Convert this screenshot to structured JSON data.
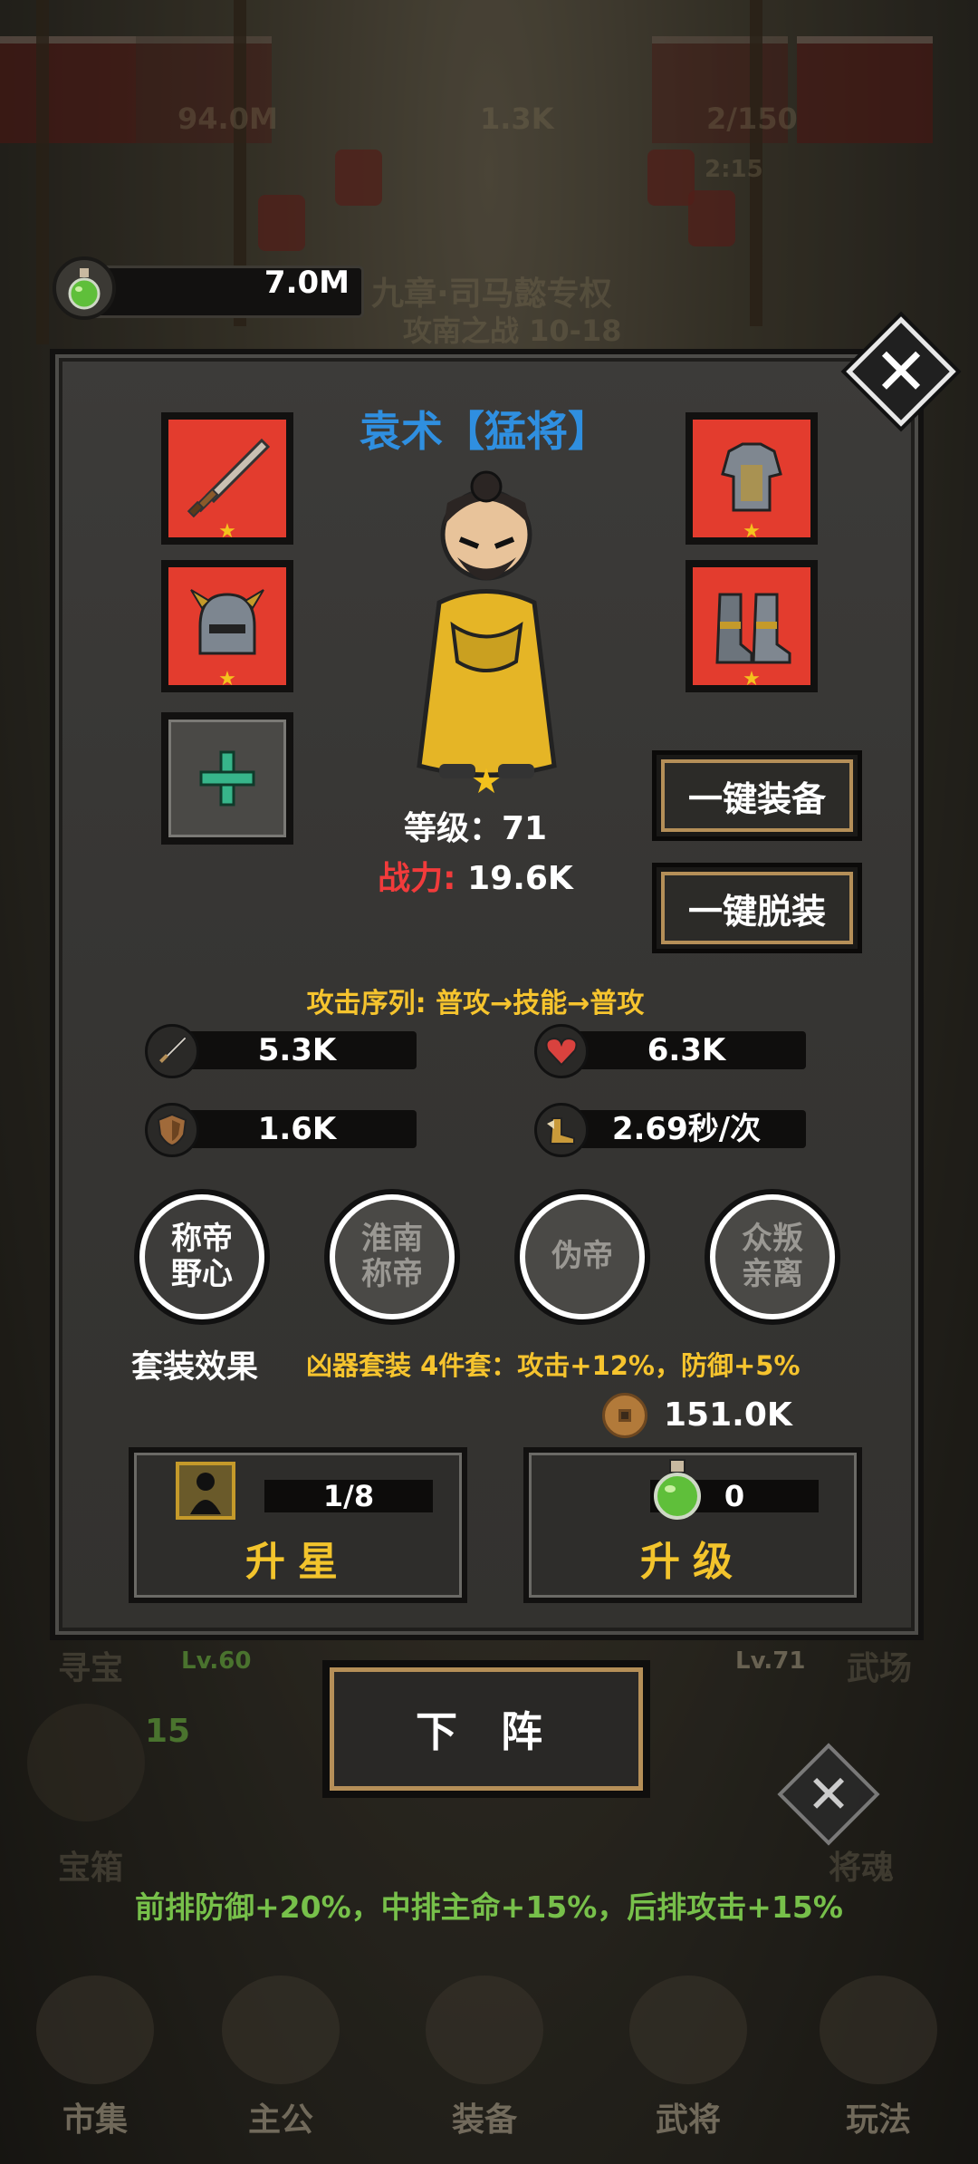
{
  "background": {
    "top_gold": "94.0M",
    "top_gems": "1.3K",
    "top_stamina": "2/150",
    "top_timer": "2:15",
    "chapter": "九章·司马懿专权",
    "stage": "攻南之战 10-18",
    "left_level": "Lv.60",
    "right_level": "Lv.71",
    "left_label": "寻宝",
    "right_label": "武场",
    "chest_label": "宝箱",
    "chest_count": "15",
    "soul_label": "将魂",
    "formation_buff": "前排防御+20%，中排主命+15%，后排攻击+15%"
  },
  "potion": {
    "value": "7.0M",
    "icon": "green-potion-icon"
  },
  "hero": {
    "name": "袁术【猛将】",
    "level_text": "等级：71",
    "power_label": "战力:",
    "power_value": "19.6K",
    "star_icon": "star-icon"
  },
  "equipment": {
    "weapon": {
      "icon": "sword-icon",
      "stars": 1
    },
    "helmet": {
      "icon": "helmet-icon",
      "stars": 1
    },
    "armor": {
      "icon": "armor-icon",
      "stars": 1
    },
    "boots": {
      "icon": "boots-icon",
      "stars": 1
    },
    "empty_slot": {
      "icon": "plus-icon"
    }
  },
  "buttons": {
    "equip_all": "一键装备",
    "unequip_all": "一键脱装",
    "dismiss": "下 阵"
  },
  "attack_sequence": "攻击序列: 普攻→技能→普攻",
  "stats": {
    "attack": "5.3K",
    "hp": "6.3K",
    "defense": "1.6K",
    "speed": "2.69秒/次"
  },
  "skills": [
    {
      "label": "称帝\n野心",
      "state": "active"
    },
    {
      "label": "淮南\n称帝",
      "state": "locked"
    },
    {
      "label": "伪帝",
      "state": "locked"
    },
    {
      "label": "众叛\n亲离",
      "state": "locked"
    }
  ],
  "set_effect": {
    "title": "套装效果",
    "desc": "凶器套装 4件套：攻击+12%，防御+5%"
  },
  "coins": "151.0K",
  "star_up": {
    "progress": "1/8",
    "label": "升星"
  },
  "level_up": {
    "progress": "0",
    "label": "升级"
  },
  "nav": [
    "市集",
    "主公",
    "装备",
    "武将",
    "玩法"
  ],
  "colors": {
    "accent_gold": "#f6c42e",
    "name_blue": "#2f8fe0",
    "power_red": "#f23b3b",
    "slot_red": "#e33c2e",
    "buff_green": "#77c04a"
  }
}
